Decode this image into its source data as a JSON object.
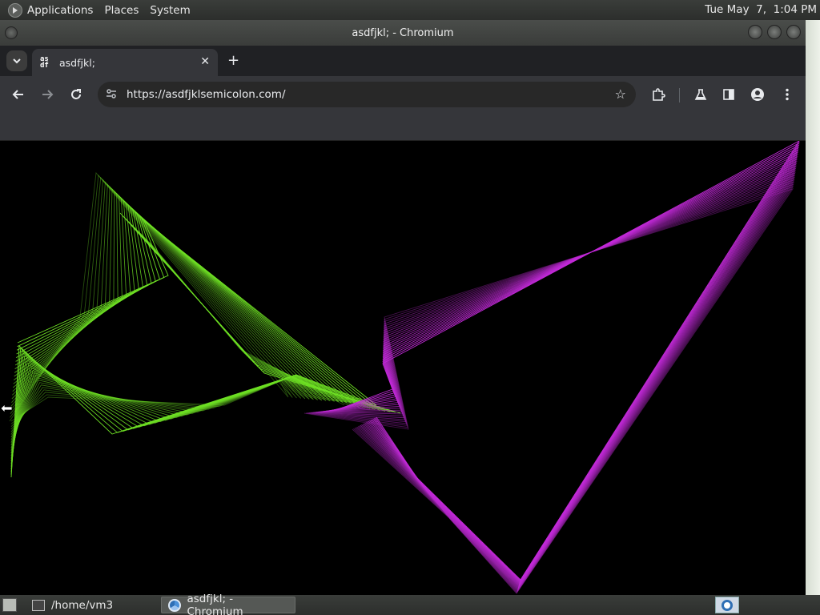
{
  "top_panel": {
    "menus": [
      "Applications",
      "Places",
      "System"
    ],
    "clock": "Tue May  7,  1:04 PM"
  },
  "window": {
    "title": "asdfjkl; - Chromium"
  },
  "browser": {
    "tab": {
      "title": "asdfjkl;",
      "favicon_text": "as df"
    },
    "url": "https://asdfjklsemicolon.com/",
    "icons": {
      "tab_search": "chevron-down-icon",
      "close_tab": "close-icon",
      "new_tab": "plus-icon",
      "back": "back-arrow-icon",
      "forward": "forward-arrow-icon",
      "reload": "reload-icon",
      "site_info": "tune-icon",
      "bookmark": "star-icon",
      "extensions": "puzzle-icon",
      "labs": "flask-icon",
      "side_panel": "side-panel-icon",
      "profile": "profile-icon",
      "menu": "kebab-menu-icon"
    }
  },
  "canvas": {
    "green": "#6ee024",
    "purple": "#c22ad8",
    "background": "#000000"
  },
  "taskbar": {
    "tasks": [
      "/home/vm3",
      "asdfjkl; - Chromium"
    ]
  }
}
